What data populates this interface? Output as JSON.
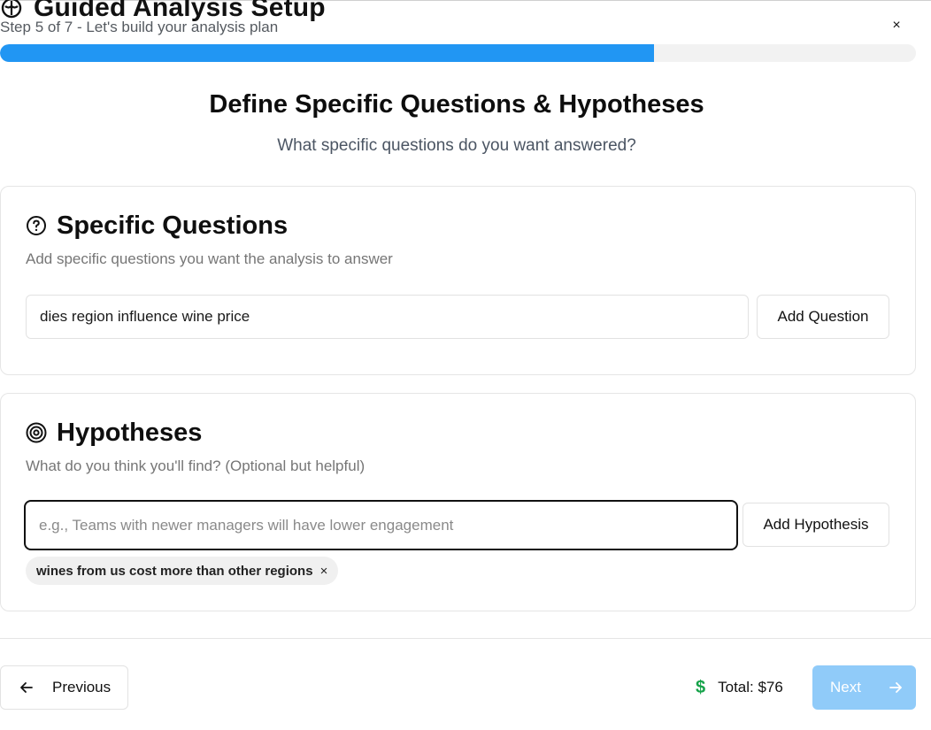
{
  "header": {
    "title": "Guided Analysis Setup",
    "subtitle": "Step 5 of 7 - Let's build your analysis plan",
    "close_label": "×",
    "logo_icon": "brain-icon"
  },
  "progress": {
    "step": 5,
    "total_steps": 7,
    "percent": 71.4,
    "fill_color": "#2196f3"
  },
  "page": {
    "title": "Define Specific Questions & Hypotheses",
    "subtitle": "What specific questions do you want answered?"
  },
  "questions": {
    "icon": "question-circle-icon",
    "title": "Specific Questions",
    "description": "Add specific questions you want the analysis to answer",
    "input_value": "dies region influence wine price",
    "input_placeholder": "",
    "add_label": "Add Question"
  },
  "hypotheses": {
    "icon": "target-icon",
    "title": "Hypotheses",
    "description": "What do you think you'll find? (Optional but helpful)",
    "input_value": "",
    "input_placeholder": "e.g., Teams with newer managers will have lower engagement",
    "add_label": "Add Hypothesis",
    "items": [
      {
        "text": "wines from us cost more than other regions",
        "remove_label": "×"
      }
    ]
  },
  "footer": {
    "previous_label": "Previous",
    "total_symbol": "$",
    "total_label": "Total: $76",
    "next_label": "Next",
    "total_color": "#16a34a",
    "next_color": "#90cbf9"
  }
}
